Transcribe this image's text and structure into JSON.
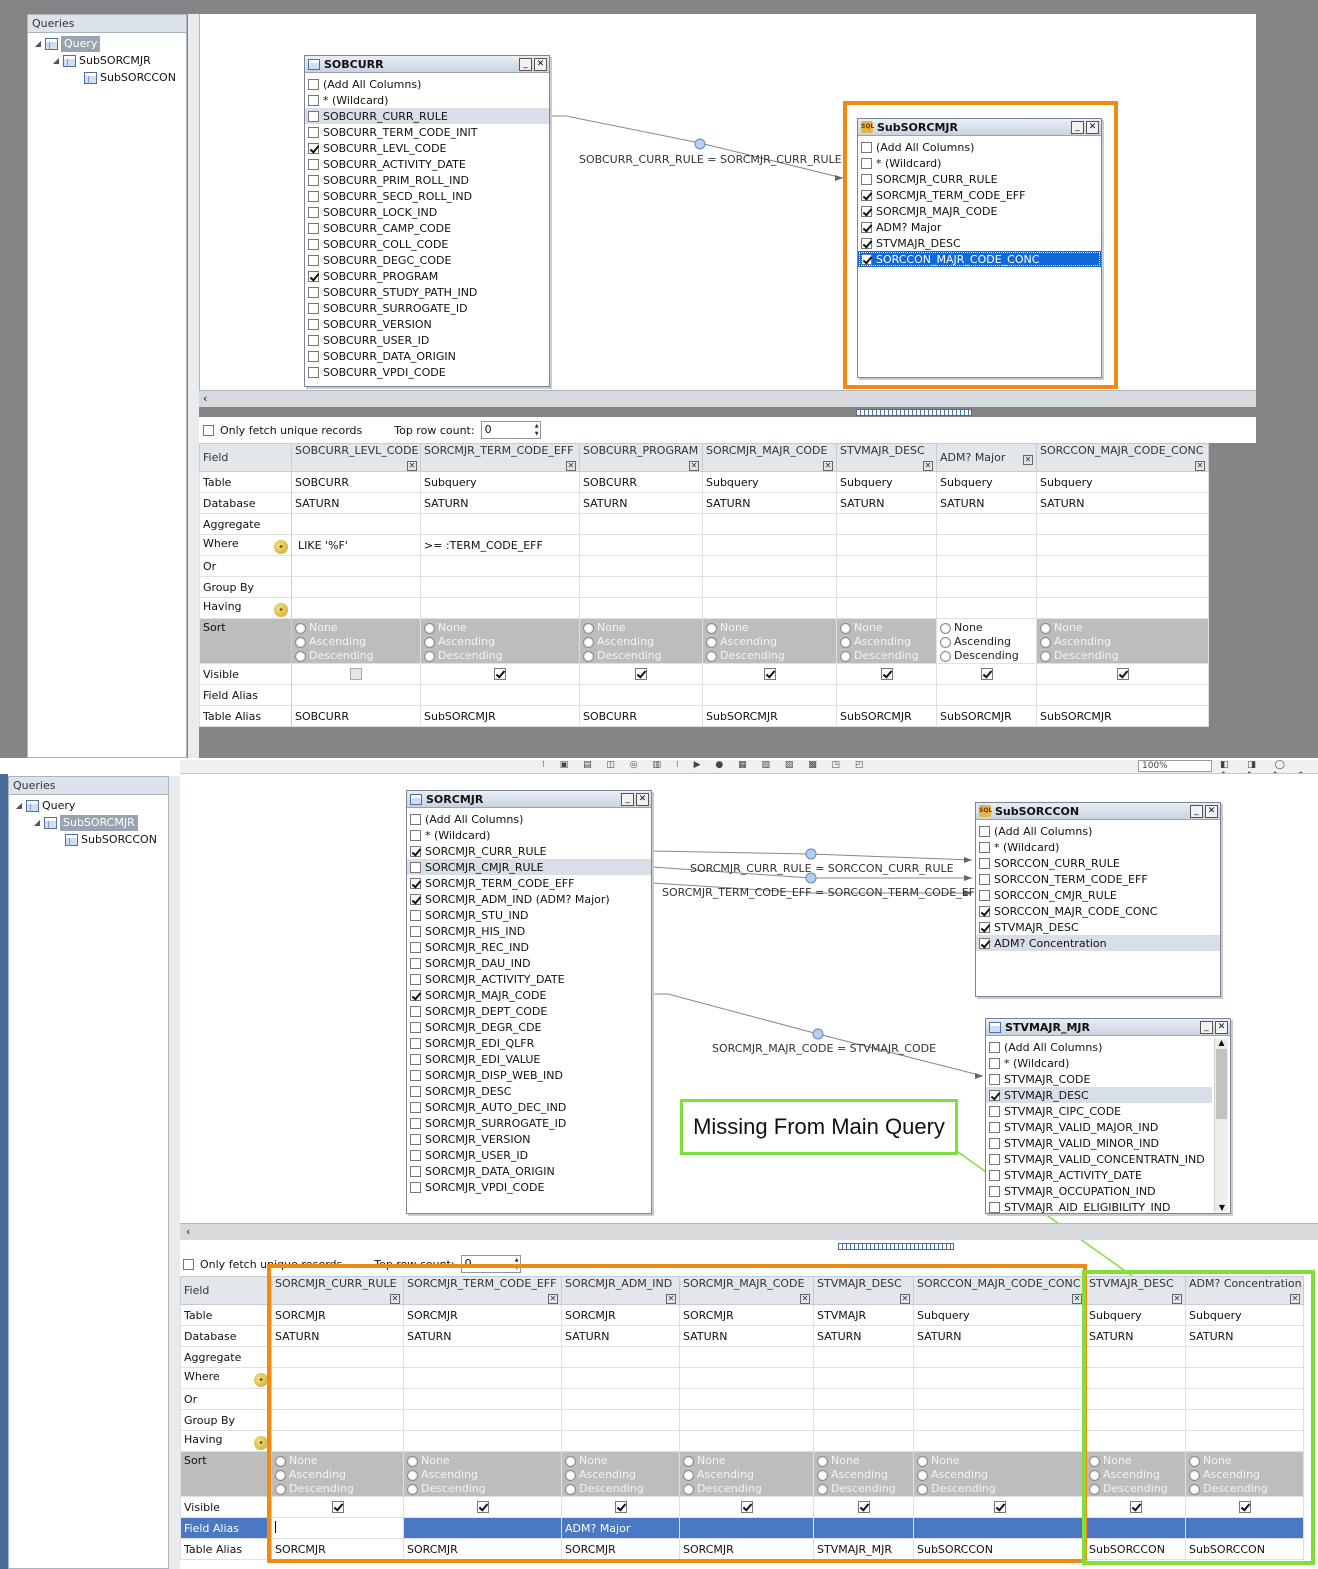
{
  "colors": {
    "orange": "#f08a12",
    "green": "#7fe03a",
    "selection": "#1268d6",
    "sort_bg": "#bdbdbd",
    "alias_row": "#4a78c2"
  },
  "top": {
    "tree": {
      "title": "Queries",
      "items": [
        {
          "label": "Query",
          "selected": true
        },
        {
          "label": "SubSORCMJR"
        },
        {
          "label": "SubSORCCON"
        }
      ]
    },
    "tables": {
      "sobcurr": {
        "title": "SOBCURR",
        "columns": [
          {
            "name": "(Add All Columns)",
            "checked": false
          },
          {
            "name": "* (Wildcard)",
            "checked": false
          },
          {
            "name": "SOBCURR_CURR_RULE",
            "checked": false,
            "highlight": true
          },
          {
            "name": "SOBCURR_TERM_CODE_INIT",
            "checked": false
          },
          {
            "name": "SOBCURR_LEVL_CODE",
            "checked": true
          },
          {
            "name": "SOBCURR_ACTIVITY_DATE",
            "checked": false
          },
          {
            "name": "SOBCURR_PRIM_ROLL_IND",
            "checked": false
          },
          {
            "name": "SOBCURR_SECD_ROLL_IND",
            "checked": false
          },
          {
            "name": "SOBCURR_LOCK_IND",
            "checked": false
          },
          {
            "name": "SOBCURR_CAMP_CODE",
            "checked": false
          },
          {
            "name": "SOBCURR_COLL_CODE",
            "checked": false
          },
          {
            "name": "SOBCURR_DEGC_CODE",
            "checked": false
          },
          {
            "name": "SOBCURR_PROGRAM",
            "checked": true
          },
          {
            "name": "SOBCURR_STUDY_PATH_IND",
            "checked": false
          },
          {
            "name": "SOBCURR_SURROGATE_ID",
            "checked": false
          },
          {
            "name": "SOBCURR_VERSION",
            "checked": false
          },
          {
            "name": "SOBCURR_USER_ID",
            "checked": false
          },
          {
            "name": "SOBCURR_DATA_ORIGIN",
            "checked": false
          },
          {
            "name": "SOBCURR_VPDI_CODE",
            "checked": false
          }
        ]
      },
      "subsorcmjr": {
        "title": "SubSORCMJR",
        "columns": [
          {
            "name": "(Add All Columns)",
            "checked": false
          },
          {
            "name": "* (Wildcard)",
            "checked": false
          },
          {
            "name": "SORCMJR_CURR_RULE",
            "checked": false
          },
          {
            "name": "SORCMJR_TERM_CODE_EFF",
            "checked": true
          },
          {
            "name": "SORCMJR_MAJR_CODE",
            "checked": true
          },
          {
            "name": "ADM? Major",
            "checked": true
          },
          {
            "name": "STVMAJR_DESC",
            "checked": true
          },
          {
            "name": "SORCCON_MAJR_CODE_CONC",
            "checked": true,
            "selected": true
          }
        ]
      }
    },
    "join_label": "SOBCURR_CURR_RULE = SORCMJR_CURR_RULE",
    "options": {
      "unique_label": "Only fetch unique records",
      "toprow_label": "Top row count:",
      "toprow_value": "0"
    },
    "grid": {
      "row_headers": [
        "Field",
        "Table",
        "Database",
        "Aggregate",
        "Where",
        "Or",
        "Group By",
        "Having",
        "Sort",
        "Visible",
        "Field Alias",
        "Table Alias"
      ],
      "sort_options": [
        "None",
        "Ascending",
        "Descending"
      ],
      "columns": [
        {
          "field": "SOBCURR_LEVL_CODE",
          "table": "SOBCURR",
          "database": "SATURN",
          "where": "LIKE '%F'",
          "visible": false,
          "table_alias": "SOBCURR"
        },
        {
          "field": "SORCMJR_TERM_CODE_EFF",
          "table": "Subquery",
          "database": "SATURN",
          "where": ">= :TERM_CODE_EFF",
          "visible": true,
          "table_alias": "SubSORCMJR"
        },
        {
          "field": "SOBCURR_PROGRAM",
          "table": "SOBCURR",
          "database": "SATURN",
          "where": "",
          "visible": true,
          "table_alias": "SOBCURR"
        },
        {
          "field": "SORCMJR_MAJR_CODE",
          "table": "Subquery",
          "database": "SATURN",
          "where": "",
          "visible": true,
          "table_alias": "SubSORCMJR"
        },
        {
          "field": "STVMAJR_DESC",
          "table": "Subquery",
          "database": "SATURN",
          "where": "",
          "visible": true,
          "table_alias": "SubSORCMJR"
        },
        {
          "field": "ADM? Major",
          "table": "Subquery",
          "database": "SATURN",
          "where": "",
          "visible": true,
          "table_alias": "SubSORCMJR",
          "light": true
        },
        {
          "field": "SORCCON_MAJR_CODE_CONC",
          "table": "Subquery",
          "database": "SATURN",
          "where": "",
          "visible": true,
          "table_alias": "SubSORCMJR"
        }
      ]
    }
  },
  "bottom": {
    "toolbar_zoom": "100%",
    "tree": {
      "title": "Queries",
      "items": [
        {
          "label": "Query"
        },
        {
          "label": "SubSORCMJR",
          "selected": true
        },
        {
          "label": "SubSORCCON"
        }
      ]
    },
    "tables": {
      "sorcmjr": {
        "title": "SORCMJR",
        "columns": [
          {
            "name": "(Add All Columns)",
            "checked": false
          },
          {
            "name": "* (Wildcard)",
            "checked": false
          },
          {
            "name": "SORCMJR_CURR_RULE",
            "checked": true
          },
          {
            "name": "SORCMJR_CMJR_RULE",
            "checked": false,
            "highlight": true
          },
          {
            "name": "SORCMJR_TERM_CODE_EFF",
            "checked": true
          },
          {
            "name": "SORCMJR_ADM_IND (ADM? Major)",
            "checked": true
          },
          {
            "name": "SORCMJR_STU_IND",
            "checked": false
          },
          {
            "name": "SORCMJR_HIS_IND",
            "checked": false
          },
          {
            "name": "SORCMJR_REC_IND",
            "checked": false
          },
          {
            "name": "SORCMJR_DAU_IND",
            "checked": false
          },
          {
            "name": "SORCMJR_ACTIVITY_DATE",
            "checked": false
          },
          {
            "name": "SORCMJR_MAJR_CODE",
            "checked": true
          },
          {
            "name": "SORCMJR_DEPT_CODE",
            "checked": false
          },
          {
            "name": "SORCMJR_DEGR_CDE",
            "checked": false
          },
          {
            "name": "SORCMJR_EDI_QLFR",
            "checked": false
          },
          {
            "name": "SORCMJR_EDI_VALUE",
            "checked": false
          },
          {
            "name": "SORCMJR_DISP_WEB_IND",
            "checked": false
          },
          {
            "name": "SORCMJR_DESC",
            "checked": false
          },
          {
            "name": "SORCMJR_AUTO_DEC_IND",
            "checked": false
          },
          {
            "name": "SORCMJR_SURROGATE_ID",
            "checked": false
          },
          {
            "name": "SORCMJR_VERSION",
            "checked": false
          },
          {
            "name": "SORCMJR_USER_ID",
            "checked": false
          },
          {
            "name": "SORCMJR_DATA_ORIGIN",
            "checked": false
          },
          {
            "name": "SORCMJR_VPDI_CODE",
            "checked": false
          }
        ]
      },
      "subsorccon": {
        "title": "SubSORCCON",
        "columns": [
          {
            "name": "(Add All Columns)",
            "checked": false
          },
          {
            "name": "* (Wildcard)",
            "checked": false
          },
          {
            "name": "SORCCON_CURR_RULE",
            "checked": false
          },
          {
            "name": "SORCCON_TERM_CODE_EFF",
            "checked": false
          },
          {
            "name": "SORCCON_CMJR_RULE",
            "checked": false
          },
          {
            "name": "SORCCON_MAJR_CODE_CONC",
            "checked": true
          },
          {
            "name": "STVMAJR_DESC",
            "checked": true
          },
          {
            "name": "ADM? Concentration",
            "checked": true,
            "highlight": true
          }
        ]
      },
      "stvmajr": {
        "title": "STVMAJR_MJR",
        "columns": [
          {
            "name": "(Add All Columns)",
            "checked": false
          },
          {
            "name": "* (Wildcard)",
            "checked": false
          },
          {
            "name": "STVMAJR_CODE",
            "checked": false
          },
          {
            "name": "STVMAJR_DESC",
            "checked": true,
            "highlight": true
          },
          {
            "name": "STVMAJR_CIPC_CODE",
            "checked": false
          },
          {
            "name": "STVMAJR_VALID_MAJOR_IND",
            "checked": false
          },
          {
            "name": "STVMAJR_VALID_MINOR_IND",
            "checked": false
          },
          {
            "name": "STVMAJR_VALID_CONCENTRATN_IND",
            "checked": false
          },
          {
            "name": "STVMAJR_ACTIVITY_DATE",
            "checked": false
          },
          {
            "name": "STVMAJR_OCCUPATION_IND",
            "checked": false
          },
          {
            "name": "STVMAJR_AID_ELIGIBILITY_IND",
            "checked": false
          }
        ]
      }
    },
    "join_labels": [
      "SORCMJR_CURR_RULE = SORCCON_CURR_RULE",
      "SORCMJR_TERM_CODE_EFF = SORCCON_TERM_CODE_EFF",
      "SORCMJR_MAJR_CODE = STVMAJR_CODE"
    ],
    "callout": "Missing From Main Query",
    "options": {
      "unique_label": "Only fetch unique records",
      "toprow_label": "Top row count:",
      "toprow_value": "0"
    },
    "grid": {
      "row_headers": [
        "Field",
        "Table",
        "Database",
        "Aggregate",
        "Where",
        "Or",
        "Group By",
        "Having",
        "Sort",
        "Visible",
        "Field Alias",
        "Table Alias"
      ],
      "sort_options": [
        "None",
        "Ascending",
        "Descending"
      ],
      "columns": [
        {
          "field": "SORCMJR_CURR_RULE",
          "table": "SORCMJR",
          "database": "SATURN",
          "field_alias": "",
          "table_alias": "SORCMJR"
        },
        {
          "field": "SORCMJR_TERM_CODE_EFF",
          "table": "SORCMJR",
          "database": "SATURN",
          "field_alias": "",
          "table_alias": "SORCMJR"
        },
        {
          "field": "SORCMJR_ADM_IND",
          "table": "SORCMJR",
          "database": "SATURN",
          "field_alias": "ADM? Major",
          "table_alias": "SORCMJR"
        },
        {
          "field": "SORCMJR_MAJR_CODE",
          "table": "SORCMJR",
          "database": "SATURN",
          "field_alias": "",
          "table_alias": "SORCMJR"
        },
        {
          "field": "STVMAJR_DESC",
          "table": "STVMAJR",
          "database": "SATURN",
          "field_alias": "",
          "table_alias": "STVMAJR_MJR"
        },
        {
          "field": "SORCCON_MAJR_CODE_CONC",
          "table": "Subquery",
          "database": "SATURN",
          "field_alias": "",
          "table_alias": "SubSORCCON"
        },
        {
          "field": "STVMAJR_DESC",
          "table": "Subquery",
          "database": "SATURN",
          "field_alias": "",
          "table_alias": "SubSORCCON"
        },
        {
          "field": "ADM? Concentration",
          "table": "Subquery",
          "database": "SATURN",
          "field_alias": "",
          "table_alias": "SubSORCCON"
        }
      ]
    }
  }
}
